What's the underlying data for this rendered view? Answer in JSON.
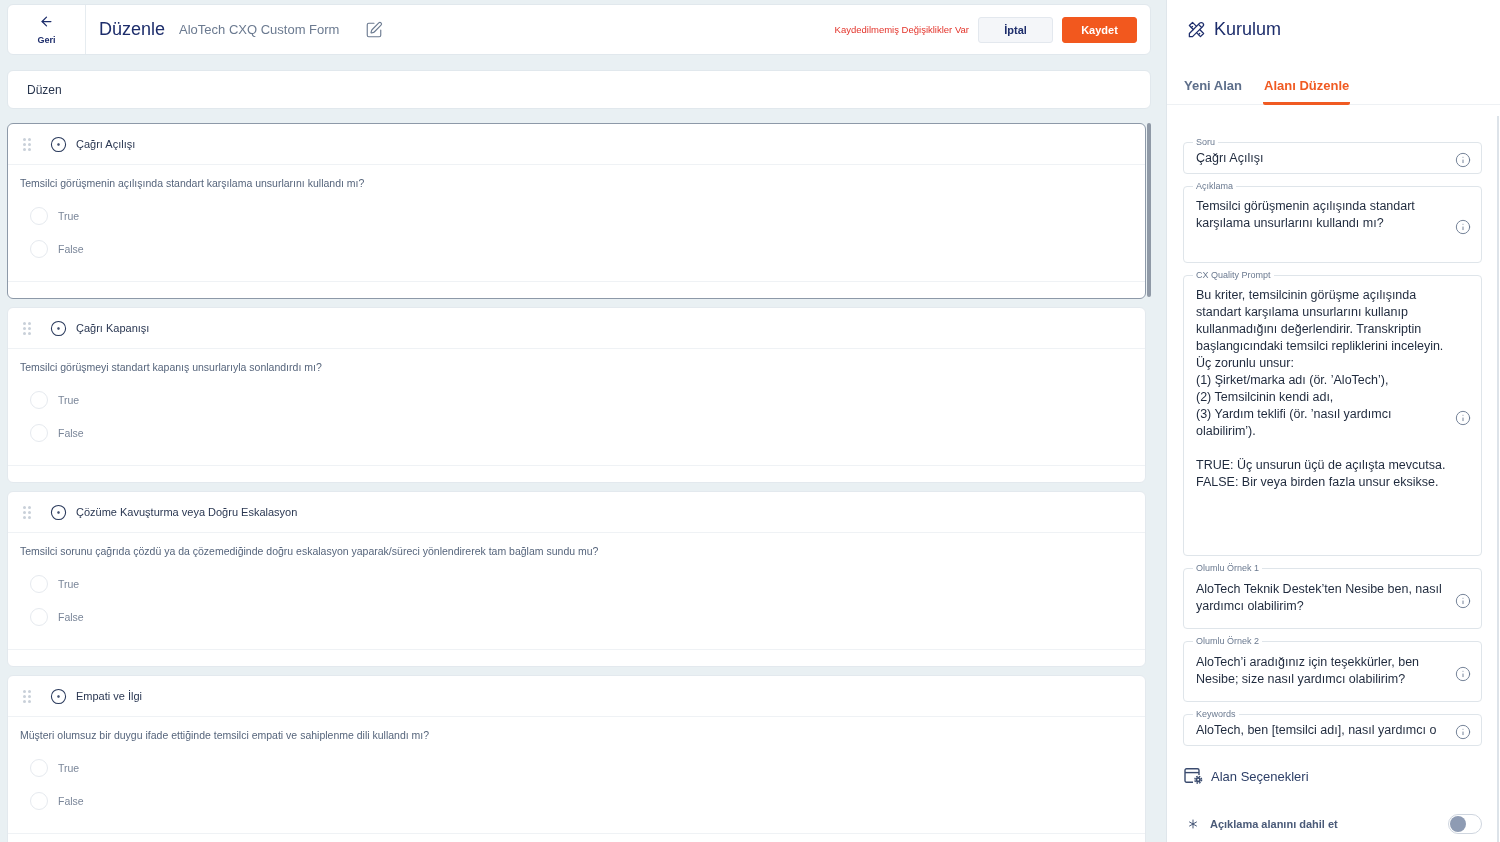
{
  "header": {
    "back_label": "Geri",
    "title": "Düzenle",
    "form_name": "AloTech CXQ Custom Form",
    "unsaved_notice": "Kaydedilmemiş Değişiklikler Var",
    "buttons": [
      {
        "label": "İptal",
        "kind": "secondary"
      },
      {
        "label": "Kaydet",
        "kind": "primary"
      }
    ]
  },
  "layout_section": {
    "title": "Düzen"
  },
  "questions": [
    {
      "title": "Çağrı Açılışı",
      "selected": true,
      "description": "Temsilci görüşmenin açılışında standart karşılama unsurlarını kullandı mı?",
      "options": [
        {
          "label": "True",
          "selected": false
        },
        {
          "label": "False",
          "selected": false
        }
      ]
    },
    {
      "title": "Çağrı Kapanışı",
      "selected": false,
      "description": "Temsilci görüşmeyi standart kapanış unsurlarıyla sonlandırdı mı?",
      "options": [
        {
          "label": "True",
          "selected": false
        },
        {
          "label": "False",
          "selected": false
        }
      ]
    },
    {
      "title": "Çözüme Kavuşturma veya Doğru Eskalasyon",
      "selected": false,
      "description": "Temsilci sorunu çağrıda çözdü ya da çözemediğinde doğru eskalasyon yaparak/süreci yönlendirerek tam bağlam sundu mu?",
      "options": [
        {
          "label": "True",
          "selected": false
        },
        {
          "label": "False",
          "selected": false
        }
      ]
    },
    {
      "title": "Empati ve İlgi",
      "selected": false,
      "description": "Müşteri olumsuz bir duygu ifade ettiğinde temsilci empati ve sahiplenme dili kullandı mı?",
      "options": [
        {
          "label": "True",
          "selected": false
        },
        {
          "label": "False",
          "selected": false
        }
      ]
    }
  ],
  "setup_panel": {
    "title": "Kurulum",
    "tabs": [
      {
        "label": "Yeni Alan",
        "selected": false
      },
      {
        "label": "Alanı Düzenle",
        "selected": true
      }
    ],
    "fields": [
      {
        "label": "Soru",
        "kind": "text",
        "value": "Çağrı Açılışı"
      },
      {
        "label": "Açıklama",
        "kind": "textarea",
        "value": "Temsilci görüşmenin açılışında standart karşılama unsurlarını kullandı mı?"
      },
      {
        "label": "CX Quality Prompt",
        "kind": "large_textarea",
        "value": "Bu kriter, temsilcinin görüşme açılışında standart karşılama unsurlarını kullanıp kullanmadığını değerlendirir. Transkriptin başlangıcındaki temsilci repliklerini inceleyin.\nÜç zorunlu unsur:\n(1) Şirket/marka adı (ör. ’AloTech’),\n(2) Temsilcinin kendi adı,\n(3) Yardım teklifi (ör. ’nasıl yardımcı olabilirim’).\n\nTRUE: Üç unsurun üçü de açılışta mevcutsa.\nFALSE: Bir veya birden fazla unsur eksikse."
      },
      {
        "label": "Olumlu Örnek 1",
        "kind": "autosize",
        "value": "AloTech Teknik Destek’ten Nesibe ben, nasıl yardımcı olabilirim?"
      },
      {
        "label": "Olumlu Örnek 2",
        "kind": "autosize",
        "value": "AloTech’i aradığınız için teşekkürler, ben Nesibe; size nasıl yardımcı olabilirim?"
      },
      {
        "label": "Keywords",
        "kind": "text",
        "value": "AloTech, ben [temsilci adı], nasıl yardımcı o"
      }
    ],
    "options_heading": "Alan Seçenekleri",
    "toggles": [
      {
        "label": "Açıklama alanını dahil et",
        "on": false
      }
    ]
  }
}
